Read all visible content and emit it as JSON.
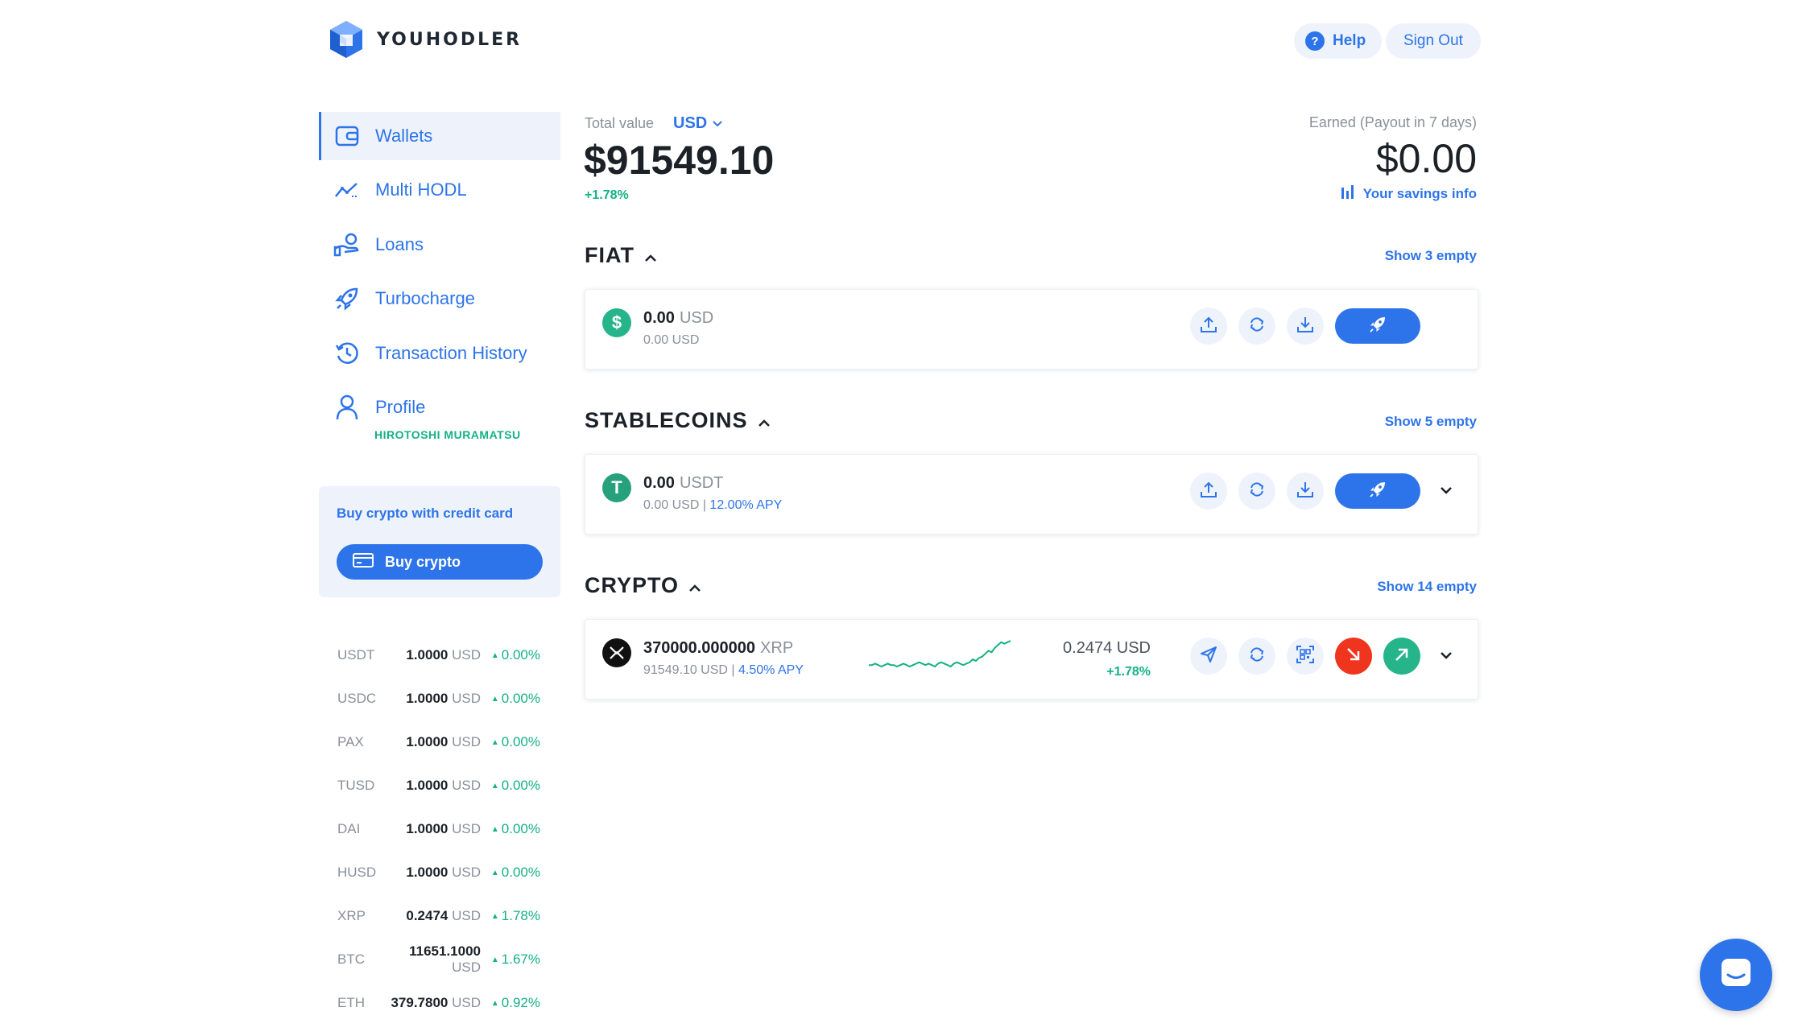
{
  "brand": {
    "name": "YOUHODLER"
  },
  "header": {
    "help_label": "Help",
    "signout_label": "Sign Out"
  },
  "sidebar": {
    "items": [
      {
        "label": "Wallets",
        "icon": "wallet-icon",
        "active": true
      },
      {
        "label": "Multi HODL",
        "icon": "chart-line-icon"
      },
      {
        "label": "Loans",
        "icon": "hand-coin-icon"
      },
      {
        "label": "Turbocharge",
        "icon": "rocket-icon"
      },
      {
        "label": "Transaction History",
        "icon": "history-icon"
      },
      {
        "label": "Profile",
        "icon": "user-icon"
      }
    ],
    "profile_name": "HIROTOSHI MURAMATSU",
    "buy_card": {
      "title": "Buy crypto with credit card",
      "button_label": "Buy crypto"
    },
    "rates": [
      {
        "symbol": "USDT",
        "price": "1.0000",
        "unit": "USD",
        "change": "0.00%"
      },
      {
        "symbol": "USDC",
        "price": "1.0000",
        "unit": "USD",
        "change": "0.00%"
      },
      {
        "symbol": "PAX",
        "price": "1.0000",
        "unit": "USD",
        "change": "0.00%"
      },
      {
        "symbol": "TUSD",
        "price": "1.0000",
        "unit": "USD",
        "change": "0.00%"
      },
      {
        "symbol": "DAI",
        "price": "1.0000",
        "unit": "USD",
        "change": "0.00%"
      },
      {
        "symbol": "HUSD",
        "price": "1.0000",
        "unit": "USD",
        "change": "0.00%"
      },
      {
        "symbol": "XRP",
        "price": "0.2474",
        "unit": "USD",
        "change": "1.78%"
      },
      {
        "symbol": "BTC",
        "price": "11651.1000",
        "unit": "USD",
        "change": "1.67%"
      },
      {
        "symbol": "ETH",
        "price": "379.7800",
        "unit": "USD",
        "change": "0.92%"
      }
    ]
  },
  "summary": {
    "total_label": "Total value",
    "currency": "USD",
    "total_value": "$91549.10",
    "total_change": "+1.78%",
    "earned_label": "Earned (Payout in 7 days)",
    "earned_value": "$0.00",
    "savings_link": "Your savings info"
  },
  "sections": {
    "fiat": {
      "title": "FIAT",
      "show_empty": "Show 3 empty",
      "wallet": {
        "amount": "0.00",
        "unit": "USD",
        "sub": "0.00 USD",
        "icon_color": "#26b48a",
        "icon_glyph": "$"
      }
    },
    "stablecoins": {
      "title": "STABLECOINS",
      "show_empty": "Show 5 empty",
      "wallet": {
        "amount": "0.00",
        "unit": "USDT",
        "sub": "0.00 USD | ",
        "apy": "12.00% APY",
        "icon_color": "#26a17b",
        "icon_glyph": "T"
      }
    },
    "crypto": {
      "title": "CRYPTO",
      "show_empty": "Show 14 empty",
      "wallet": {
        "amount": "370000.000000",
        "unit": "XRP",
        "sub": "91549.10 USD | ",
        "apy": "4.50% APY",
        "price": "0.2474 USD",
        "change": "+1.78%",
        "icon_color": "#111111",
        "spark_color": "#14b184",
        "down_color": "#f0351f",
        "up_color": "#26b48a",
        "sparkline": [
          22,
          22,
          21,
          22,
          23,
          22,
          21,
          22,
          22,
          23,
          22,
          21,
          22,
          23,
          22,
          21,
          20,
          21,
          22,
          21,
          22,
          23,
          21,
          20,
          21,
          22,
          23,
          21,
          20,
          21,
          22,
          21,
          20,
          18,
          19,
          17,
          16,
          14,
          12,
          13,
          10,
          8,
          6,
          7,
          6,
          5
        ]
      }
    }
  },
  "colors": {
    "accent": "#2d74ea",
    "green": "#14b184",
    "bg_tint": "#eef3fb"
  }
}
